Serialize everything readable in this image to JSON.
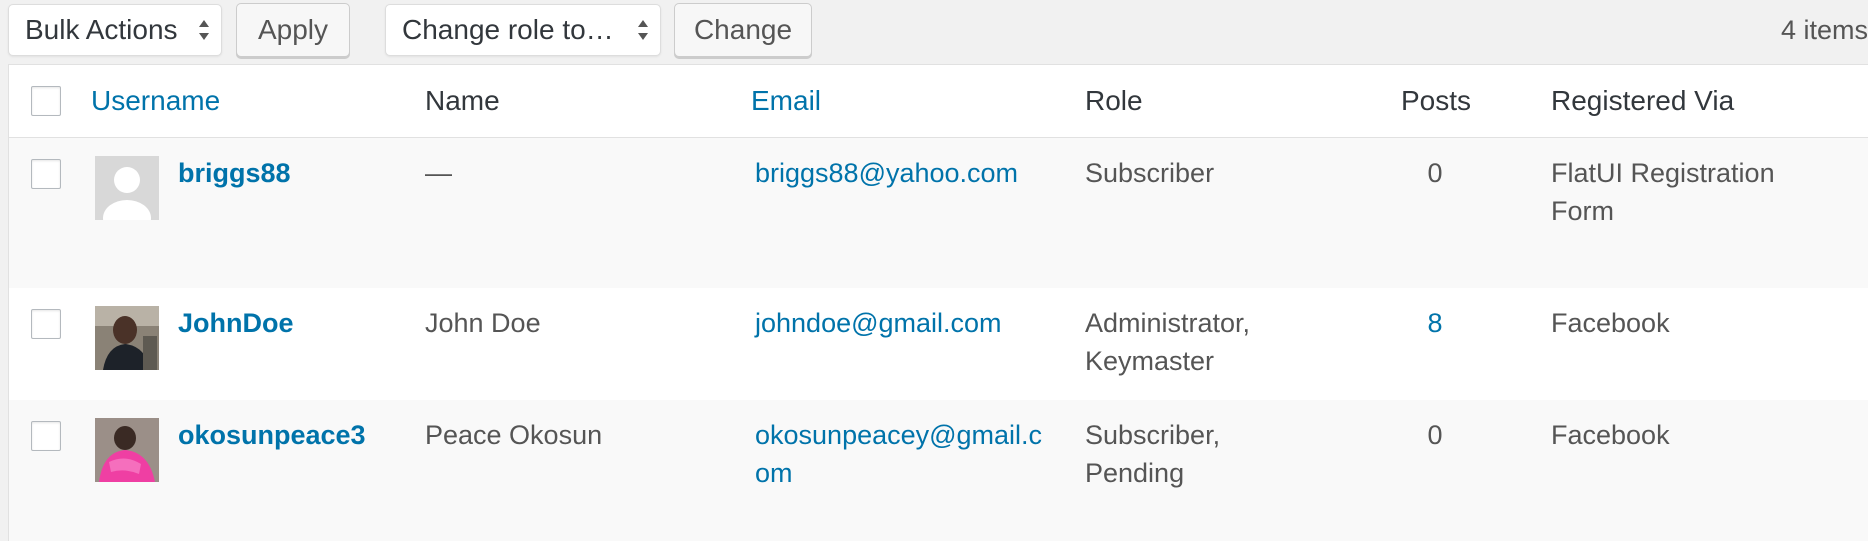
{
  "toolbar": {
    "bulk_actions_label": "Bulk Actions",
    "apply_label": "Apply",
    "change_role_label": "Change role to…",
    "change_label": "Change",
    "items_count": "4 items"
  },
  "table": {
    "headers": {
      "username": "Username",
      "name": "Name",
      "email": "Email",
      "role": "Role",
      "posts": "Posts",
      "registered_via": "Registered Via"
    },
    "rows": [
      {
        "username": "briggs88",
        "name": "—",
        "email_line1": "briggs88@yahoo.com",
        "email_line2": "",
        "role_line1": "Subscriber",
        "role_line2": "",
        "posts": "0",
        "registered_line1": "FlatUI Registration",
        "registered_line2": "Form"
      },
      {
        "username": "JohnDoe",
        "name": "John Doe",
        "email_line1": "johndoe@gmail.com",
        "email_line2": "",
        "role_line1": "Administrator,",
        "role_line2": "Keymaster",
        "posts": "8",
        "registered_line1": "Facebook",
        "registered_line2": ""
      },
      {
        "username": "okosunpeace3",
        "name": "Peace Okosun",
        "email_line1": "okosunpeacey@gmail.c",
        "email_line2": "om",
        "role_line1": "Subscriber,",
        "role_line2": "Pending",
        "posts": "0",
        "registered_line1": "Facebook",
        "registered_line2": ""
      }
    ]
  },
  "colors": {
    "link": "#0073aa",
    "text": "#555555",
    "background": "#f1f1f1"
  }
}
